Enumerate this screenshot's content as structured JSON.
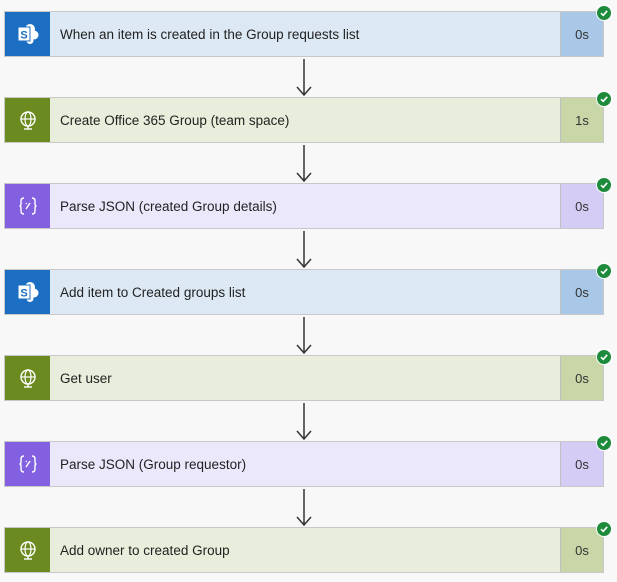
{
  "steps": [
    {
      "label": "When an item is created in the Group requests list",
      "duration": "0s",
      "type": "sharepoint",
      "icon": "sharepoint-icon",
      "status": "succeeded"
    },
    {
      "label": "Create Office 365 Group (team space)",
      "duration": "1s",
      "type": "http",
      "icon": "globe-icon",
      "status": "succeeded"
    },
    {
      "label": "Parse JSON (created Group details)",
      "duration": "0s",
      "type": "json",
      "icon": "braces-icon",
      "status": "succeeded"
    },
    {
      "label": "Add item to Created groups list",
      "duration": "0s",
      "type": "sharepoint",
      "icon": "sharepoint-icon",
      "status": "succeeded"
    },
    {
      "label": "Get user",
      "duration": "0s",
      "type": "http",
      "icon": "globe-icon",
      "status": "succeeded"
    },
    {
      "label": "Parse JSON (Group requestor)",
      "duration": "0s",
      "type": "json",
      "icon": "braces-icon",
      "status": "succeeded"
    },
    {
      "label": "Add owner to created Group",
      "duration": "0s",
      "type": "http",
      "icon": "globe-icon",
      "status": "succeeded"
    }
  ],
  "colors": {
    "sharepoint": "#1b6ec2",
    "http": "#6b8a1f",
    "json": "#8360e0",
    "success": "#1e8a3c"
  }
}
